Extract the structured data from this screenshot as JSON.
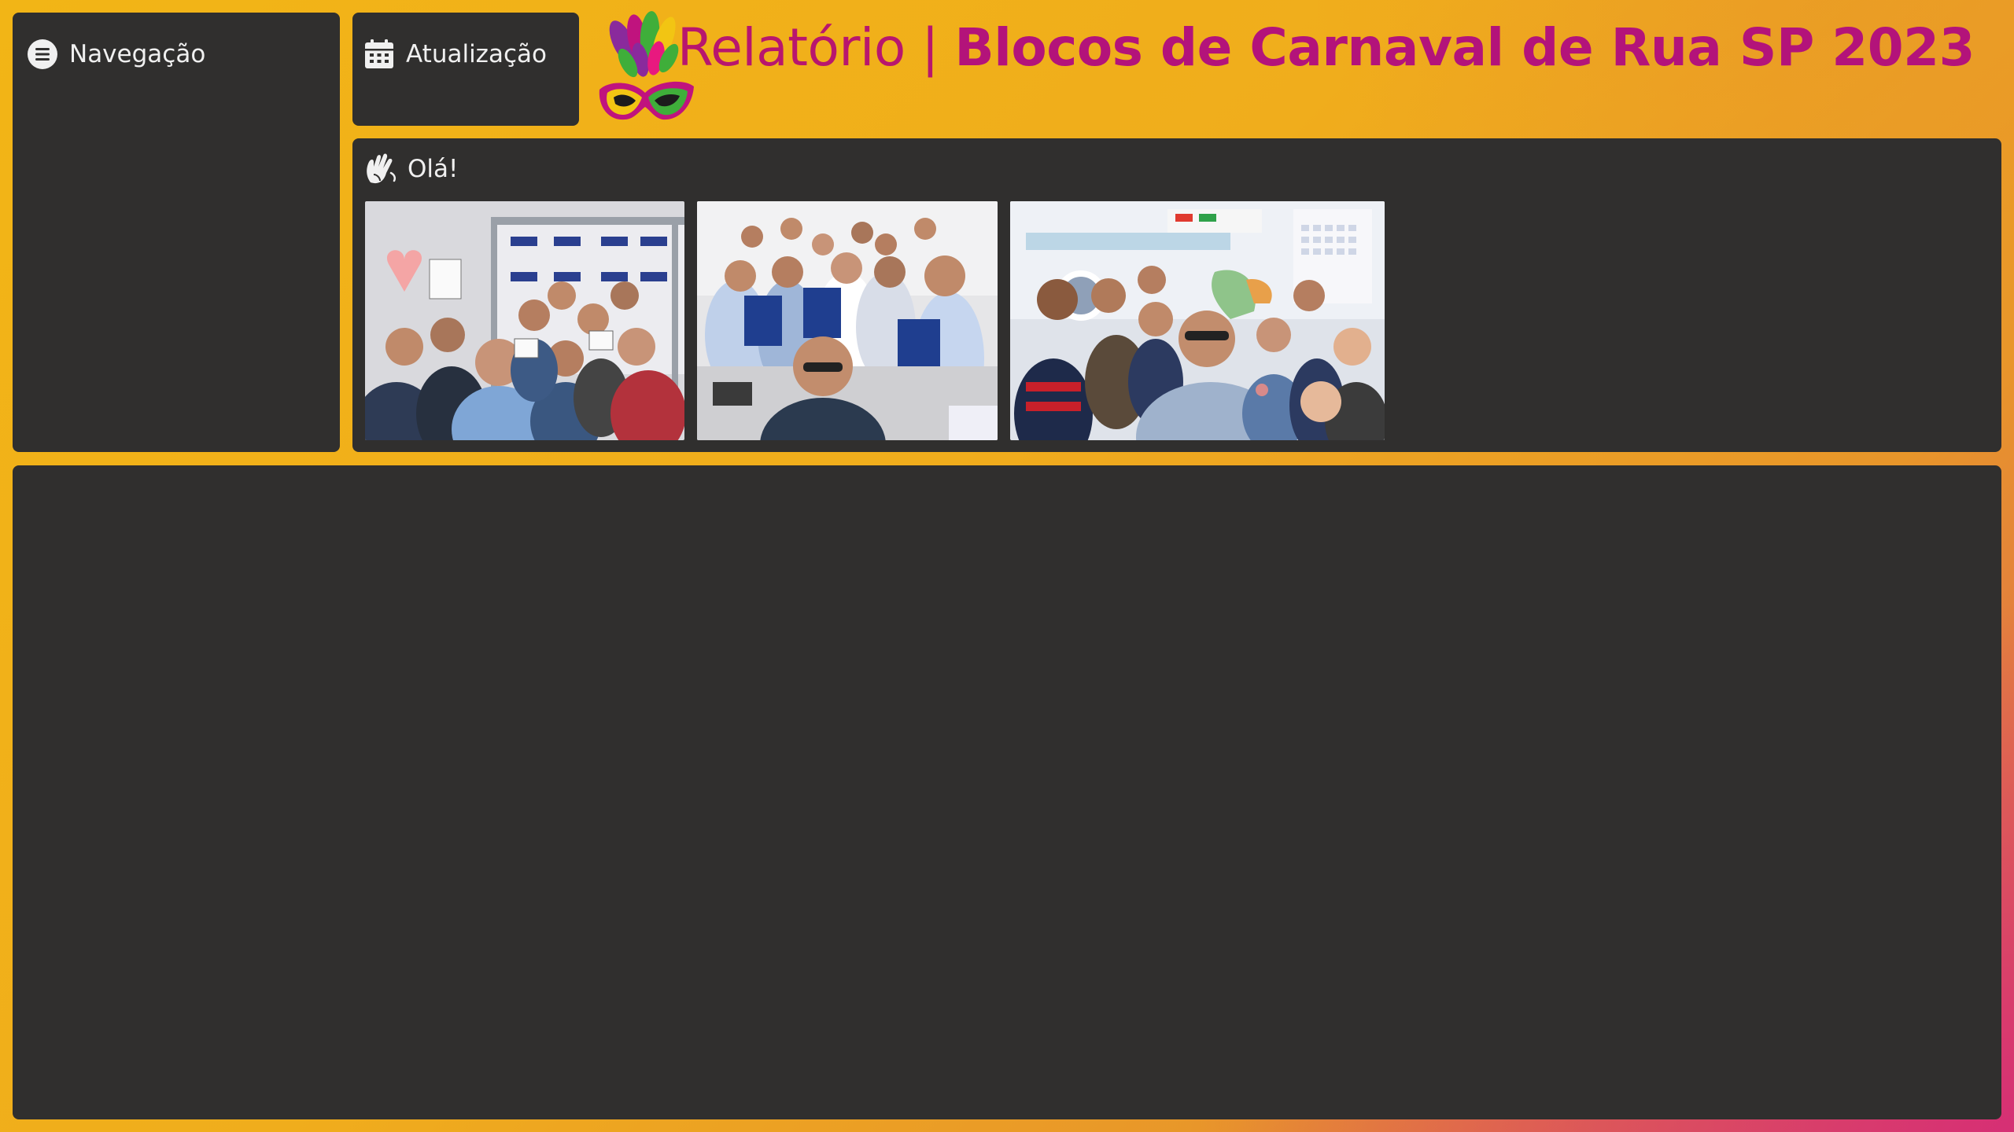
{
  "nav": {
    "label": "Navegação",
    "icon": "menu-circle-icon"
  },
  "update": {
    "label": "Atualização",
    "icon": "calendar-icon"
  },
  "header": {
    "title_prefix": "Relatório",
    "separator": "|",
    "title_main": "Blocos de Carnaval de Rua SP 2023"
  },
  "hello": {
    "label": "Olá!",
    "icon": "waving-hands-icon",
    "photos": [
      {
        "name": "group-photo-1"
      },
      {
        "name": "group-photo-2"
      },
      {
        "name": "group-photo-3"
      }
    ]
  },
  "colors": {
    "panel": "#302f2e",
    "title": "#b3137a",
    "background_start": "#f2b516",
    "background_end": "#d6287a"
  }
}
